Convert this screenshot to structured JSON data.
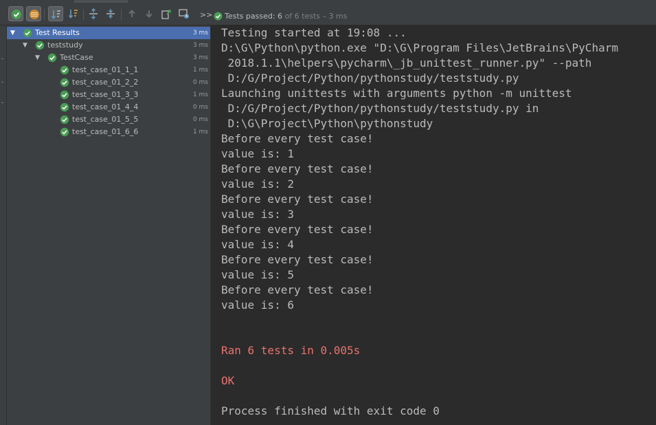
{
  "toolbar": {
    "buttons": [
      {
        "name": "show-passed-icon",
        "toggled": true
      },
      {
        "name": "show-ignored-icon",
        "toggled": true
      },
      {
        "name": "sort-alphabetically-icon",
        "toggled": true
      },
      {
        "name": "sort-by-duration-icon",
        "toggled": false
      },
      {
        "name": "expand-all-icon",
        "toggled": false
      },
      {
        "name": "collapse-all-icon",
        "toggled": false
      },
      {
        "name": "previous-failed-icon",
        "toggled": false
      },
      {
        "name": "next-failed-icon",
        "toggled": false
      },
      {
        "name": "export-results-icon",
        "toggled": false
      },
      {
        "name": "import-results-icon",
        "toggled": false
      }
    ],
    "more_icon": ">>",
    "status": {
      "label": "Tests passed:",
      "count": "6",
      "of_total": "of 6 tests",
      "duration": "– 3 ms"
    }
  },
  "tree": {
    "items": [
      {
        "label": "Test Results",
        "time": "3 ms",
        "expanded": true,
        "selected": true
      },
      {
        "label": "teststudy",
        "time": "3 ms",
        "expanded": true,
        "selected": false
      },
      {
        "label": "TestCase",
        "time": "3 ms",
        "expanded": true,
        "selected": false
      },
      {
        "label": "test_case_01_1_1",
        "time": "1 ms",
        "selected": false
      },
      {
        "label": "test_case_01_2_2",
        "time": "0 ms",
        "selected": false
      },
      {
        "label": "test_case_01_3_3",
        "time": "1 ms",
        "selected": false
      },
      {
        "label": "test_case_01_4_4",
        "time": "0 ms",
        "selected": false
      },
      {
        "label": "test_case_01_5_5",
        "time": "0 ms",
        "selected": false
      },
      {
        "label": "test_case_01_6_6",
        "time": "1 ms",
        "selected": false
      }
    ]
  },
  "console": {
    "lines": [
      {
        "text": "Testing started at 19:08 ..."
      },
      {
        "text": "D:\\G\\Python\\python.exe \"D:\\G\\Program Files\\JetBrains\\PyCharm"
      },
      {
        "text": " 2018.1.1\\helpers\\pycharm\\_jb_unittest_runner.py\" --path"
      },
      {
        "text": " D:/G/Project/Python/pythonstudy/teststudy.py"
      },
      {
        "text": "Launching unittests with arguments python -m unittest"
      },
      {
        "text": " D:/G/Project/Python/pythonstudy/teststudy.py in"
      },
      {
        "text": " D:\\G\\Project\\Python\\pythonstudy"
      },
      {
        "text": "Before every test case!"
      },
      {
        "text": "value is: 1"
      },
      {
        "text": "Before every test case!"
      },
      {
        "text": "value is: 2"
      },
      {
        "text": "Before every test case!"
      },
      {
        "text": "value is: 3"
      },
      {
        "text": "Before every test case!"
      },
      {
        "text": "value is: 4"
      },
      {
        "text": "Before every test case!"
      },
      {
        "text": "value is: 5"
      },
      {
        "text": "Before every test case!"
      },
      {
        "text": "value is: 6"
      },
      {
        "text": ""
      },
      {
        "text": ""
      },
      {
        "text": "Ran 6 tests in 0.005s",
        "stderr": true
      },
      {
        "text": ""
      },
      {
        "text": "OK",
        "stderr": true
      },
      {
        "text": ""
      },
      {
        "text": "Process finished with exit code 0"
      }
    ]
  },
  "colors": {
    "pass_green": "#499c54",
    "selection_blue": "#4b6eaf",
    "stderr_red": "#e8736c"
  }
}
